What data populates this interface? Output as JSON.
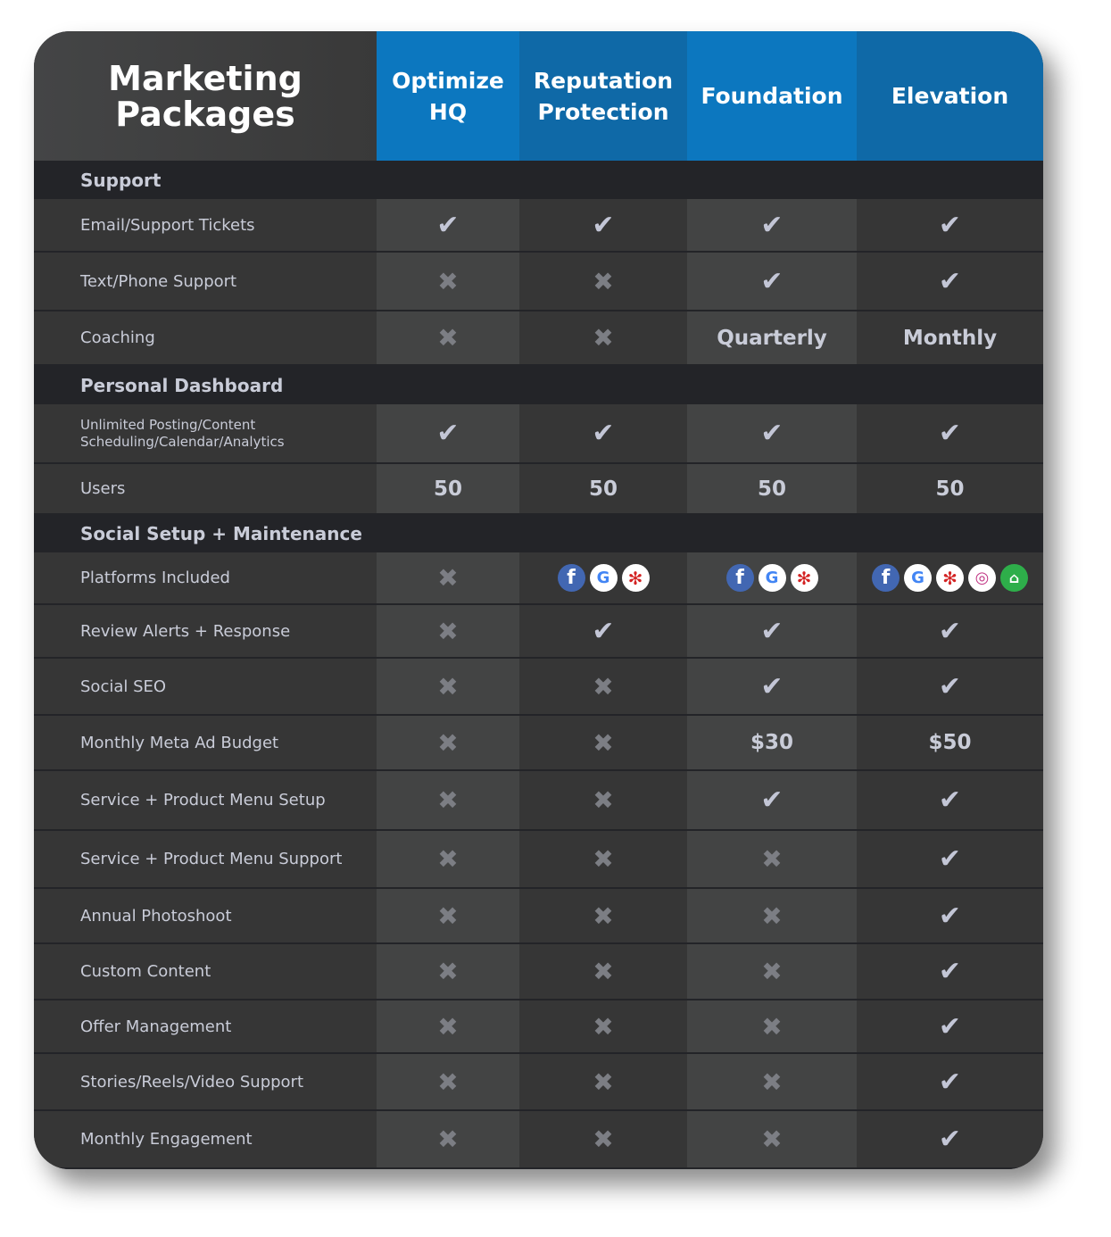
{
  "title_line1": "Marketing",
  "title_line2": "Packages",
  "columns": [
    {
      "line1": "Optimize",
      "line2": "HQ"
    },
    {
      "line1": "Reputation",
      "line2": "Protection"
    },
    {
      "line1": "Foundation",
      "line2": ""
    },
    {
      "line1": "Elevation",
      "line2": ""
    }
  ],
  "colors": {
    "header_blue": "#0c77bf",
    "header_blue_alt": "#0f69a7",
    "check": "#c3c6d6",
    "x": "#7c7e84"
  },
  "rows": [
    {
      "section": "Support"
    },
    {
      "label": "Email/Support Tickets",
      "cells": [
        "check",
        "check",
        "check",
        "check"
      ]
    },
    {
      "label": "Text/Phone Support",
      "cells": [
        "x",
        "x",
        "check",
        "check"
      ]
    },
    {
      "label": "Coaching",
      "cells": [
        "x",
        "x",
        "Quarterly",
        "Monthly"
      ]
    },
    {
      "section": "Personal Dashboard"
    },
    {
      "label": "Unlimited Posting/Content Scheduling/Calendar/Analytics",
      "small": true,
      "cells": [
        "check",
        "check",
        "check",
        "check"
      ]
    },
    {
      "label": "Users",
      "cells": [
        "50",
        "50",
        "50",
        "50"
      ]
    },
    {
      "section": "Social Setup + Maintenance"
    },
    {
      "label": "Platforms Included",
      "cells": [
        "x",
        [
          "facebook",
          "google",
          "yelp"
        ],
        [
          "facebook",
          "google",
          "yelp"
        ],
        [
          "facebook",
          "google",
          "yelp",
          "instagram",
          "home"
        ]
      ]
    },
    {
      "label": "Review Alerts + Response",
      "cells": [
        "x",
        "check",
        "check",
        "check"
      ]
    },
    {
      "label": "Social SEO",
      "cells": [
        "x",
        "x",
        "check",
        "check"
      ]
    },
    {
      "label": "Monthly Meta Ad Budget",
      "cells": [
        "x",
        "x",
        "$30",
        "$50"
      ]
    },
    {
      "label": "Service + Product Menu Setup",
      "cells": [
        "x",
        "x",
        "check",
        "check"
      ]
    },
    {
      "label": "Service + Product Menu Support",
      "cells": [
        "x",
        "x",
        "x",
        "check"
      ]
    },
    {
      "label": "Annual Photoshoot",
      "cells": [
        "x",
        "x",
        "x",
        "check"
      ]
    },
    {
      "label": "Custom Content",
      "cells": [
        "x",
        "x",
        "x",
        "check"
      ]
    },
    {
      "label": "Offer Management",
      "cells": [
        "x",
        "x",
        "x",
        "check"
      ]
    },
    {
      "label": "Stories/Reels/Video Support",
      "cells": [
        "x",
        "x",
        "x",
        "check"
      ]
    },
    {
      "label": "Monthly Engagement",
      "cells": [
        "x",
        "x",
        "x",
        "check"
      ]
    }
  ]
}
